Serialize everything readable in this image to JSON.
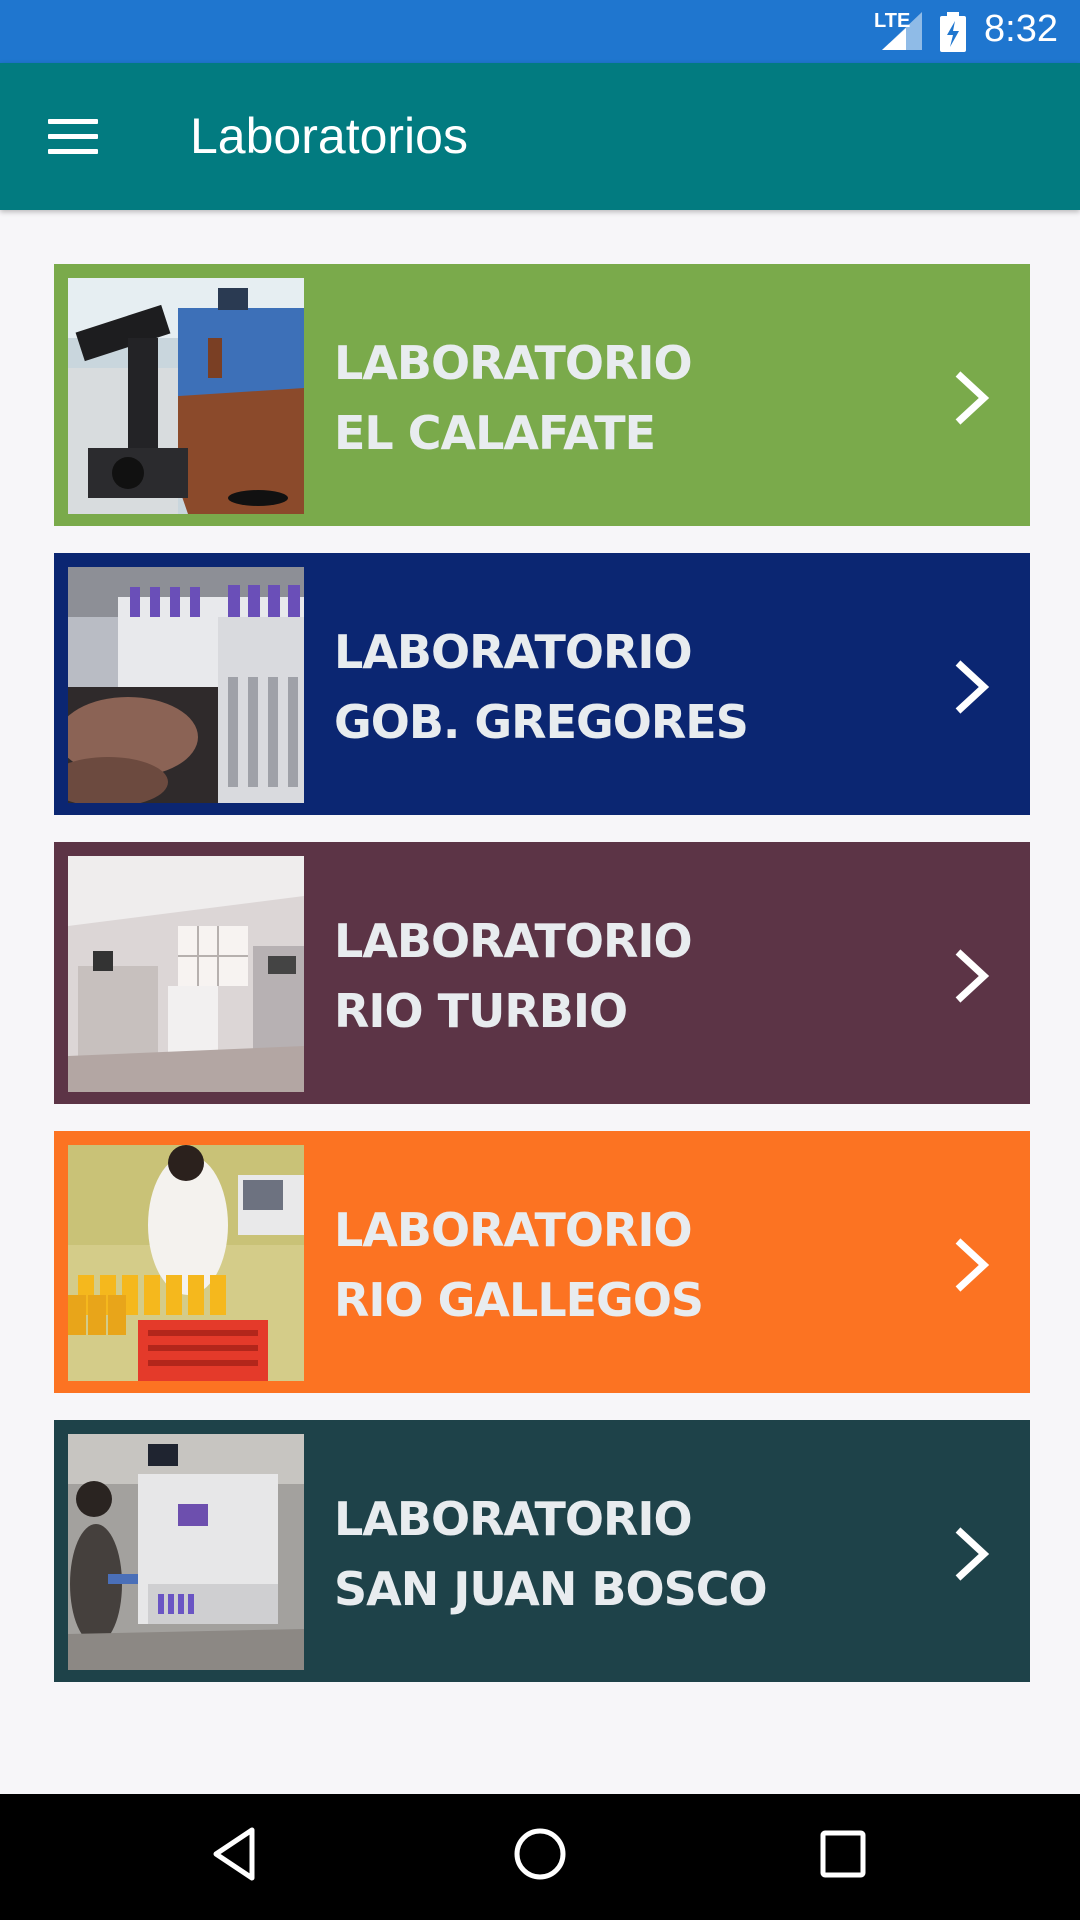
{
  "status_bar": {
    "network": "LTE",
    "time": "8:32",
    "icons": [
      "signal-icon",
      "battery-charging-icon"
    ]
  },
  "app_bar": {
    "title": "Laboratorios",
    "menu_icon": "hamburger-menu-icon"
  },
  "labs": [
    {
      "line1": "LABORATORIO",
      "line2": "EL CALAFATE",
      "color": "#7aaa4b",
      "photo": "microscope-lab-photo"
    },
    {
      "line1": "LABORATORIO",
      "line2": "GOB. GREGORES",
      "color": "#0b2672",
      "photo": "test-tubes-photo"
    },
    {
      "line1": "LABORATORIO",
      "line2": "RIO TURBIO",
      "color": "#5c3446",
      "photo": "lab-room-photo"
    },
    {
      "line1": "LABORATORIO",
      "line2": "RIO GALLEGOS",
      "color": "#fc7322",
      "photo": "sample-rack-photo"
    },
    {
      "line1": "LABORATORIO",
      "line2": "SAN JUAN BOSCO",
      "color": "#1e4249",
      "photo": "analyzer-machine-photo"
    }
  ],
  "nav_bar": {
    "buttons": [
      "back-icon",
      "home-icon",
      "recents-icon"
    ]
  }
}
